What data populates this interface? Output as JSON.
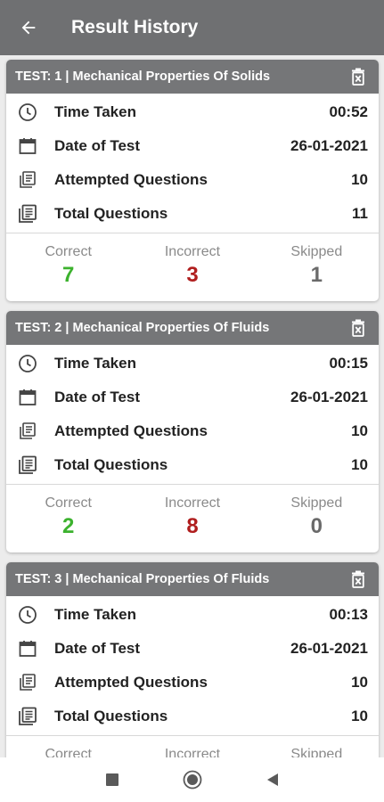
{
  "header": {
    "title": "Result History",
    "back_icon": "arrow-left-icon"
  },
  "labels": {
    "time_taken": "Time Taken",
    "date_of_test": "Date of Test",
    "attempted_questions": "Attempted Questions",
    "total_questions": "Total Questions",
    "correct": "Correct",
    "incorrect": "Incorrect",
    "skipped": "Skipped"
  },
  "colors": {
    "header_bg": "#6f7072",
    "card_header_bg": "#757678",
    "correct": "#3cb22e",
    "incorrect": "#b01e1e",
    "skipped": "#6a6a6a"
  },
  "results": [
    {
      "title": "TEST: 1 | Mechanical Properties Of Solids",
      "time_taken": "00:52",
      "date_of_test": "26-01-2021",
      "attempted_questions": "10",
      "total_questions": "11",
      "correct": "7",
      "incorrect": "3",
      "skipped": "1"
    },
    {
      "title": "TEST: 2 | Mechanical Properties Of Fluids",
      "time_taken": "00:15",
      "date_of_test": "26-01-2021",
      "attempted_questions": "10",
      "total_questions": "10",
      "correct": "2",
      "incorrect": "8",
      "skipped": "0"
    },
    {
      "title": "TEST: 3 | Mechanical Properties Of Fluids",
      "time_taken": "00:13",
      "date_of_test": "26-01-2021",
      "attempted_questions": "10",
      "total_questions": "10",
      "correct": "",
      "incorrect": "",
      "skipped": ""
    }
  ],
  "system_nav": {
    "recent_icon": "square-icon",
    "home_icon": "circle-icon",
    "back_icon": "triangle-back-icon"
  }
}
